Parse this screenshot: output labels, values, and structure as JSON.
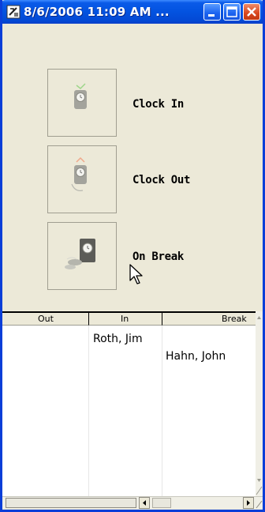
{
  "window": {
    "title": "8/6/2006 11:09 AM ...",
    "controls": {
      "minimize": "minimize",
      "maximize": "maximize",
      "close": "close"
    }
  },
  "actions": [
    {
      "label": "Clock In",
      "icon": "clock-in-icon"
    },
    {
      "label": "Clock Out",
      "icon": "clock-out-icon"
    },
    {
      "label": "On Break",
      "icon": "on-break-icon"
    }
  ],
  "list": {
    "columns": [
      "Out",
      "In",
      "Break"
    ],
    "rows": [
      {
        "in": "Roth, Jim",
        "break": ""
      },
      {
        "in": "",
        "break": "Hahn, John"
      }
    ]
  },
  "colors": {
    "titlebar": "#0353e0",
    "frame": "#0a3ed8",
    "close": "#d9461c",
    "face": "#ece9d8"
  }
}
